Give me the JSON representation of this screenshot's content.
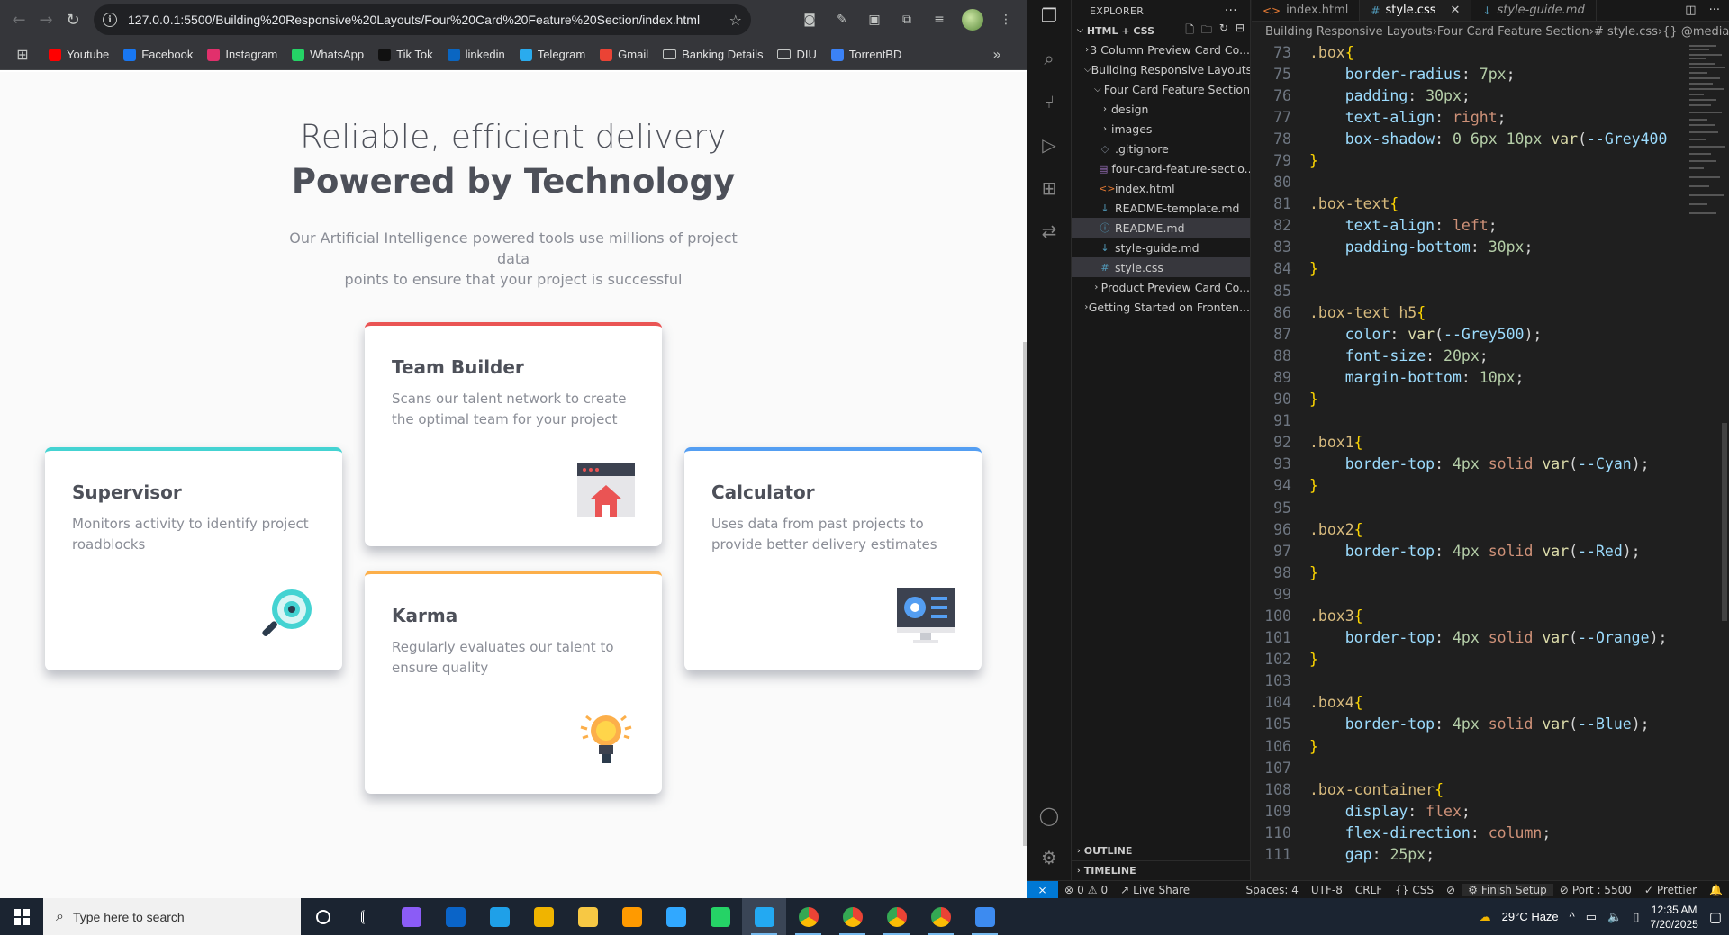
{
  "browser": {
    "url": "127.0.0.1:5500/Building%20Responsive%20Layouts/Four%20Card%20Feature%20Section/index.html",
    "bookmarks": [
      {
        "label": "Youtube",
        "color": "#ff0000"
      },
      {
        "label": "Facebook",
        "color": "#1877f2"
      },
      {
        "label": "Instagram",
        "color": "#e1306c"
      },
      {
        "label": "WhatsApp",
        "color": "#25d366"
      },
      {
        "label": "Tik Tok",
        "color": "#111111"
      },
      {
        "label": "linkedin",
        "color": "#0a66c2"
      },
      {
        "label": "Telegram",
        "color": "#2aabee"
      },
      {
        "label": "Gmail",
        "color": "#ea4335"
      },
      {
        "label": "Banking Details",
        "color": "folder"
      },
      {
        "label": "DIU",
        "color": "folder"
      },
      {
        "label": "TorrentBD",
        "color": "#3b82f6"
      }
    ]
  },
  "page": {
    "heading_light": "Reliable, efficient delivery",
    "heading_bold": "Powered by Technology",
    "intro_line1": "Our Artificial Intelligence powered tools use millions of project data",
    "intro_line2": "points to ensure that your project is successful",
    "cards": [
      {
        "title": "Supervisor",
        "desc": "Monitors activity to identify project roadblocks",
        "color": "#44d3d2",
        "icon": "magnifier-icon"
      },
      {
        "title": "Team Builder",
        "desc": "Scans our talent network to create the optimal team for your project",
        "color": "#ea5454",
        "icon": "team-builder-icon"
      },
      {
        "title": "Karma",
        "desc": "Regularly evaluates our talent to ensure quality",
        "color": "#fcaf4a",
        "icon": "lightbulb-icon"
      },
      {
        "title": "Calculator",
        "desc": "Uses data from past projects to provide better delivery estimates",
        "color": "#549ef2",
        "icon": "monitor-icon"
      }
    ]
  },
  "vscode": {
    "explorer_title": "EXPLORER",
    "section": "HTML + CSS",
    "tree": [
      {
        "label": "3 Column Preview Card Co...",
        "depth": 1,
        "type": "folder",
        "open": false
      },
      {
        "label": "Building Responsive Layouts",
        "depth": 1,
        "type": "folder",
        "open": true
      },
      {
        "label": "Four Card Feature Section",
        "depth": 2,
        "type": "folder",
        "open": true
      },
      {
        "label": "design",
        "depth": 3,
        "type": "folder",
        "open": false
      },
      {
        "label": "images",
        "depth": 3,
        "type": "folder",
        "open": false
      },
      {
        "label": ".gitignore",
        "depth": 3,
        "type": "git"
      },
      {
        "label": "four-card-feature-sectio...",
        "depth": 3,
        "type": "file"
      },
      {
        "label": "index.html",
        "depth": 3,
        "type": "html"
      },
      {
        "label": "README-template.md",
        "depth": 3,
        "type": "md"
      },
      {
        "label": "README.md",
        "depth": 3,
        "type": "info"
      },
      {
        "label": "style-guide.md",
        "depth": 3,
        "type": "md"
      },
      {
        "label": "style.css",
        "depth": 3,
        "type": "css"
      },
      {
        "label": "Product Preview Card Co...",
        "depth": 2,
        "type": "folder",
        "open": false
      },
      {
        "label": "Getting Started on Fronten...",
        "depth": 1,
        "type": "folder",
        "open": false
      }
    ],
    "outline": "OUTLINE",
    "timeline": "TIMELINE",
    "tabs": [
      {
        "label": "index.html",
        "icon": "<>",
        "active": false
      },
      {
        "label": "style.css",
        "icon": "#",
        "active": true
      },
      {
        "label": "style-guide.md",
        "icon": "↓",
        "active": false
      }
    ],
    "breadcrumb": [
      "Building Responsive Layouts",
      "Four Card Feature Section",
      "# style.css",
      "{} @media onl"
    ],
    "code": [
      {
        "n": "73",
        "tokens": [
          [
            "sel-c",
            ".box"
          ],
          [
            "br",
            "{"
          ]
        ]
      },
      {
        "n": "75",
        "tokens": [
          [
            "pu",
            "    "
          ],
          [
            "prop",
            "border-radius"
          ],
          [
            "pu",
            ": "
          ],
          [
            "num",
            "7px"
          ],
          [
            "pu",
            ";"
          ]
        ]
      },
      {
        "n": "76",
        "tokens": [
          [
            "pu",
            "    "
          ],
          [
            "prop",
            "padding"
          ],
          [
            "pu",
            ": "
          ],
          [
            "num",
            "30px"
          ],
          [
            "pu",
            ";"
          ]
        ]
      },
      {
        "n": "77",
        "tokens": [
          [
            "pu",
            "    "
          ],
          [
            "prop",
            "text-align"
          ],
          [
            "pu",
            ": "
          ],
          [
            "kw",
            "right"
          ],
          [
            "pu",
            ";"
          ]
        ]
      },
      {
        "n": "78",
        "tokens": [
          [
            "pu",
            "    "
          ],
          [
            "prop",
            "box-shadow"
          ],
          [
            "pu",
            ": "
          ],
          [
            "num",
            "0 6px 10px "
          ],
          [
            "fn",
            "var"
          ],
          [
            "pu",
            "("
          ],
          [
            "var",
            "--Grey400"
          ]
        ]
      },
      {
        "n": "79",
        "tokens": [
          [
            "br",
            "}"
          ]
        ]
      },
      {
        "n": "80",
        "tokens": []
      },
      {
        "n": "81",
        "tokens": [
          [
            "sel-c",
            ".box-text"
          ],
          [
            "br",
            "{"
          ]
        ]
      },
      {
        "n": "82",
        "tokens": [
          [
            "pu",
            "    "
          ],
          [
            "prop",
            "text-align"
          ],
          [
            "pu",
            ": "
          ],
          [
            "kw",
            "left"
          ],
          [
            "pu",
            ";"
          ]
        ]
      },
      {
        "n": "83",
        "tokens": [
          [
            "pu",
            "    "
          ],
          [
            "prop",
            "padding-bottom"
          ],
          [
            "pu",
            ": "
          ],
          [
            "num",
            "30px"
          ],
          [
            "pu",
            ";"
          ]
        ]
      },
      {
        "n": "84",
        "tokens": [
          [
            "br",
            "}"
          ]
        ]
      },
      {
        "n": "85",
        "tokens": []
      },
      {
        "n": "86",
        "tokens": [
          [
            "sel-c",
            ".box-text h5"
          ],
          [
            "br",
            "{"
          ]
        ]
      },
      {
        "n": "87",
        "tokens": [
          [
            "pu",
            "    "
          ],
          [
            "prop",
            "color"
          ],
          [
            "pu",
            ": "
          ],
          [
            "fn",
            "var"
          ],
          [
            "pu",
            "("
          ],
          [
            "var",
            "--Grey500"
          ],
          [
            "pu",
            ");"
          ]
        ]
      },
      {
        "n": "88",
        "tokens": [
          [
            "pu",
            "    "
          ],
          [
            "prop",
            "font-size"
          ],
          [
            "pu",
            ": "
          ],
          [
            "num",
            "20px"
          ],
          [
            "pu",
            ";"
          ]
        ]
      },
      {
        "n": "89",
        "tokens": [
          [
            "pu",
            "    "
          ],
          [
            "prop",
            "margin-bottom"
          ],
          [
            "pu",
            ": "
          ],
          [
            "num",
            "10px"
          ],
          [
            "pu",
            ";"
          ]
        ]
      },
      {
        "n": "90",
        "tokens": [
          [
            "br",
            "}"
          ]
        ]
      },
      {
        "n": "91",
        "tokens": []
      },
      {
        "n": "92",
        "tokens": [
          [
            "sel-c",
            ".box1"
          ],
          [
            "br",
            "{"
          ]
        ]
      },
      {
        "n": "93",
        "tokens": [
          [
            "pu",
            "    "
          ],
          [
            "prop",
            "border-top"
          ],
          [
            "pu",
            ": "
          ],
          [
            "num",
            "4px "
          ],
          [
            "kw",
            "solid "
          ],
          [
            "fn",
            "var"
          ],
          [
            "pu",
            "("
          ],
          [
            "var",
            "--Cyan"
          ],
          [
            "pu",
            ");"
          ]
        ]
      },
      {
        "n": "94",
        "tokens": [
          [
            "br",
            "}"
          ]
        ]
      },
      {
        "n": "95",
        "tokens": []
      },
      {
        "n": "96",
        "tokens": [
          [
            "sel-c",
            ".box2"
          ],
          [
            "br",
            "{"
          ]
        ]
      },
      {
        "n": "97",
        "tokens": [
          [
            "pu",
            "    "
          ],
          [
            "prop",
            "border-top"
          ],
          [
            "pu",
            ": "
          ],
          [
            "num",
            "4px "
          ],
          [
            "kw",
            "solid "
          ],
          [
            "fn",
            "var"
          ],
          [
            "pu",
            "("
          ],
          [
            "var",
            "--Red"
          ],
          [
            "pu",
            ");"
          ]
        ]
      },
      {
        "n": "98",
        "tokens": [
          [
            "br",
            "}"
          ]
        ]
      },
      {
        "n": "99",
        "tokens": []
      },
      {
        "n": "100",
        "tokens": [
          [
            "sel-c",
            ".box3"
          ],
          [
            "br",
            "{"
          ]
        ]
      },
      {
        "n": "101",
        "tokens": [
          [
            "pu",
            "    "
          ],
          [
            "prop",
            "border-top"
          ],
          [
            "pu",
            ": "
          ],
          [
            "num",
            "4px "
          ],
          [
            "kw",
            "solid "
          ],
          [
            "fn",
            "var"
          ],
          [
            "pu",
            "("
          ],
          [
            "var",
            "--Orange"
          ],
          [
            "pu",
            ");"
          ]
        ]
      },
      {
        "n": "102",
        "tokens": [
          [
            "br",
            "}"
          ]
        ]
      },
      {
        "n": "103",
        "tokens": []
      },
      {
        "n": "104",
        "tokens": [
          [
            "sel-c",
            ".box4"
          ],
          [
            "br",
            "{"
          ]
        ]
      },
      {
        "n": "105",
        "tokens": [
          [
            "pu",
            "    "
          ],
          [
            "prop",
            "border-top"
          ],
          [
            "pu",
            ": "
          ],
          [
            "num",
            "4px "
          ],
          [
            "kw",
            "solid "
          ],
          [
            "fn",
            "var"
          ],
          [
            "pu",
            "("
          ],
          [
            "var",
            "--Blue"
          ],
          [
            "pu",
            ");"
          ]
        ]
      },
      {
        "n": "106",
        "tokens": [
          [
            "br",
            "}"
          ]
        ]
      },
      {
        "n": "107",
        "tokens": []
      },
      {
        "n": "108",
        "tokens": [
          [
            "sel-c",
            ".box-container"
          ],
          [
            "br",
            "{"
          ]
        ]
      },
      {
        "n": "109",
        "tokens": [
          [
            "pu",
            "    "
          ],
          [
            "prop",
            "display"
          ],
          [
            "pu",
            ": "
          ],
          [
            "kw",
            "flex"
          ],
          [
            "pu",
            ";"
          ]
        ]
      },
      {
        "n": "110",
        "tokens": [
          [
            "pu",
            "    "
          ],
          [
            "prop",
            "flex-direction"
          ],
          [
            "pu",
            ": "
          ],
          [
            "kw",
            "column"
          ],
          [
            "pu",
            ";"
          ]
        ]
      },
      {
        "n": "111",
        "tokens": [
          [
            "pu",
            "    "
          ],
          [
            "prop",
            "gap"
          ],
          [
            "pu",
            ": "
          ],
          [
            "num",
            "25px"
          ],
          [
            "pu",
            ";"
          ]
        ]
      }
    ],
    "status": {
      "errors": "0",
      "warnings": "0",
      "live_share": "Live Share",
      "spaces": "Spaces: 4",
      "encoding": "UTF-8",
      "eol": "CRLF",
      "language": "CSS",
      "finish_setup": "Finish Setup",
      "port": "Port : 5500",
      "prettier": "Prettier"
    }
  },
  "taskbar": {
    "search_placeholder": "Type here to search",
    "weather": "29°C  Haze",
    "time": "12:35 AM",
    "date": "7/20/2025",
    "apps": [
      {
        "name": "task-view",
        "color": "#ffffff"
      },
      {
        "name": "widgets",
        "color": "#ffffff"
      },
      {
        "name": "copilot",
        "color": "#8b5cf6"
      },
      {
        "name": "outlook",
        "color": "#0a64c8"
      },
      {
        "name": "edge",
        "color": "#1fa0e8"
      },
      {
        "name": "store",
        "color": "#f0b400"
      },
      {
        "name": "file-explorer",
        "color": "#f7c844"
      },
      {
        "name": "illustrator",
        "color": "#ff9a00"
      },
      {
        "name": "photoshop",
        "color": "#31a8ff"
      },
      {
        "name": "whatsapp",
        "color": "#25d366"
      },
      {
        "name": "vscode",
        "color": "#23a9f2"
      },
      {
        "name": "chrome",
        "color": "#34a853"
      },
      {
        "name": "chrome-2",
        "color": "#34a853"
      },
      {
        "name": "chrome-3",
        "color": "#34a853"
      },
      {
        "name": "chrome-4",
        "color": "#34a853"
      },
      {
        "name": "photos",
        "color": "#3d8bf0"
      }
    ]
  }
}
